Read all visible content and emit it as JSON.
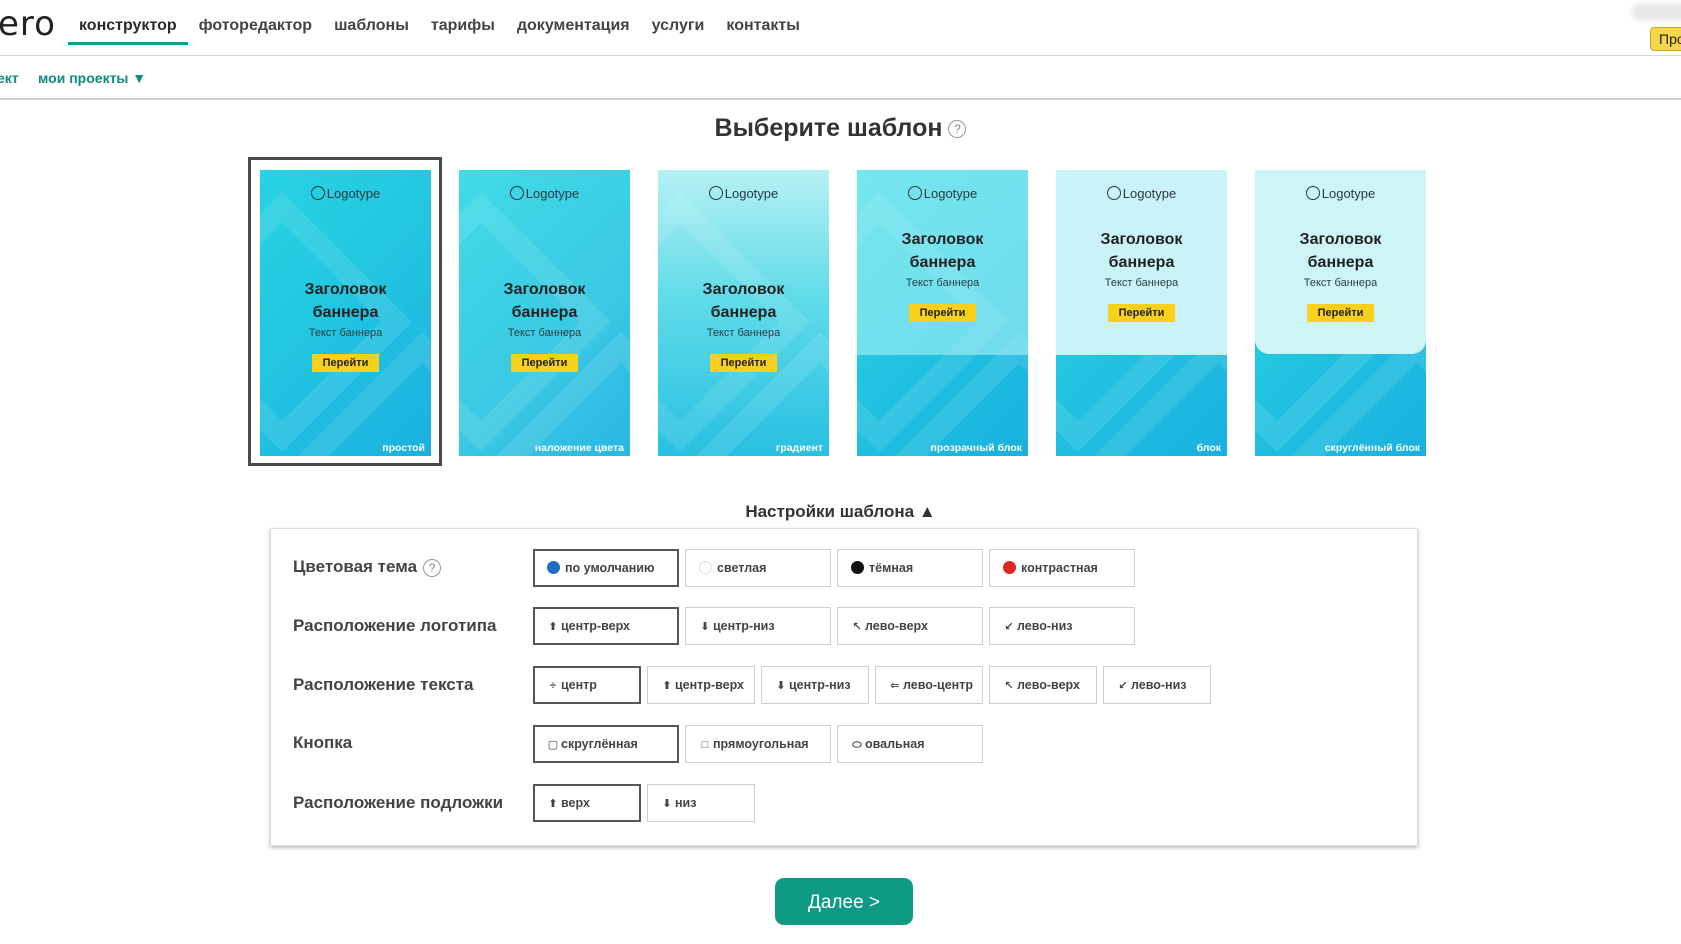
{
  "header": {
    "logo": "ero",
    "nav": [
      "конструктор",
      "фоторедактор",
      "шаблоны",
      "тарифы",
      "документация",
      "услуги",
      "контакты"
    ],
    "active_nav": 0,
    "pro_badge": "Про"
  },
  "subnav": {
    "left_cut": "ект",
    "projects": "мои проекты ▼"
  },
  "heading": "Выберите шаблон",
  "help_glyph": "?",
  "templates": [
    {
      "logo": "Logotype",
      "title1": "Заголовок",
      "title2": "баннера",
      "text": "Текст баннера",
      "button": "Перейти",
      "caption": "простой"
    },
    {
      "logo": "Logotype",
      "title1": "Заголовок",
      "title2": "баннера",
      "text": "Текст баннера",
      "button": "Перейти",
      "caption": "наложение цвета"
    },
    {
      "logo": "Logotype",
      "title1": "Заголовок",
      "title2": "баннера",
      "text": "Текст баннера",
      "button": "Перейти",
      "caption": "градиент"
    },
    {
      "logo": "Logotype",
      "title1": "Заголовок",
      "title2": "баннера",
      "text": "Текст баннера",
      "button": "Перейти",
      "caption": "прозрачный блок"
    },
    {
      "logo": "Logotype",
      "title1": "Заголовок",
      "title2": "баннера",
      "text": "Текст баннера",
      "button": "Перейти",
      "caption": "блок"
    },
    {
      "logo": "Logotype",
      "title1": "Заголовок",
      "title2": "баннера",
      "text": "Текст баннера",
      "button": "Перейти",
      "caption": "скруглённый блок"
    }
  ],
  "selected_template": 0,
  "settings": {
    "title": "Настройки шаблона ▲",
    "color_theme": {
      "label": "Цветовая тема",
      "options": [
        {
          "label": "по умолчанию",
          "color": "#1f6fc4"
        },
        {
          "label": "светлая",
          "color": "#ffffff"
        },
        {
          "label": "тёмная",
          "color": "#111111"
        },
        {
          "label": "контрастная",
          "color": "#e02424"
        }
      ],
      "selected": 0
    },
    "logo_position": {
      "label": "Расположение логотипа",
      "options": [
        {
          "icon": "⬆",
          "label": "центр-верх"
        },
        {
          "icon": "⬇",
          "label": "центр-низ"
        },
        {
          "icon": "↖",
          "label": "лево-верх"
        },
        {
          "icon": "↙",
          "label": "лево-низ"
        }
      ],
      "selected": 0
    },
    "text_position": {
      "label": "Расположение текста",
      "options": [
        {
          "icon": "÷",
          "label": "центр"
        },
        {
          "icon": "⬆",
          "label": "центр-верх"
        },
        {
          "icon": "⬇",
          "label": "центр-низ"
        },
        {
          "icon": "⇐",
          "label": "лево-центр"
        },
        {
          "icon": "↖",
          "label": "лево-верх"
        },
        {
          "icon": "↙",
          "label": "лево-низ"
        }
      ],
      "selected": 0
    },
    "button_shape": {
      "label": "Кнопка",
      "options": [
        {
          "icon": "▢",
          "label": "скруглённая"
        },
        {
          "icon": "□",
          "label": "прямоугольная"
        },
        {
          "icon": "⬭",
          "label": "овальная"
        }
      ],
      "selected": 0
    },
    "backdrop_position": {
      "label": "Расположение подложки",
      "options": [
        {
          "icon": "⬆",
          "label": "верх"
        },
        {
          "icon": "⬇",
          "label": "низ"
        }
      ],
      "selected": 0
    }
  },
  "next_button": "Далее >"
}
